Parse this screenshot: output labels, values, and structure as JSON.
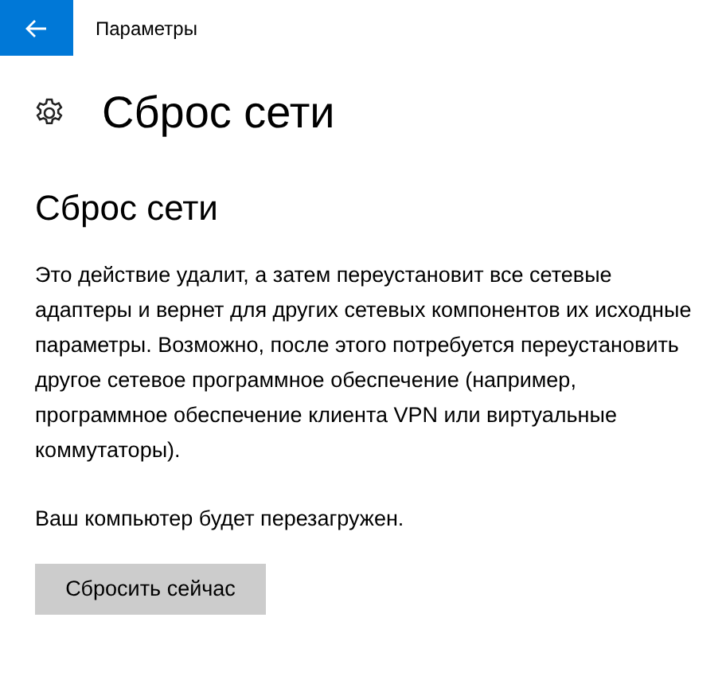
{
  "window": {
    "title": "Параметры"
  },
  "page_title": "Сброс сети",
  "section_title": "Сброс сети",
  "description": "Это действие удалит, а затем переустановит все сетевые адаптеры и вернет для других сетевых компонентов их исходные параметры. Возможно, после этого потребуется переустановить другое сетевое программное обеспечение (например, программное обеспечение клиента VPN или виртуальные коммутаторы).",
  "note": "Ваш компьютер будет перезагружен.",
  "buttons": [
    "Сбросить сейчас"
  ]
}
